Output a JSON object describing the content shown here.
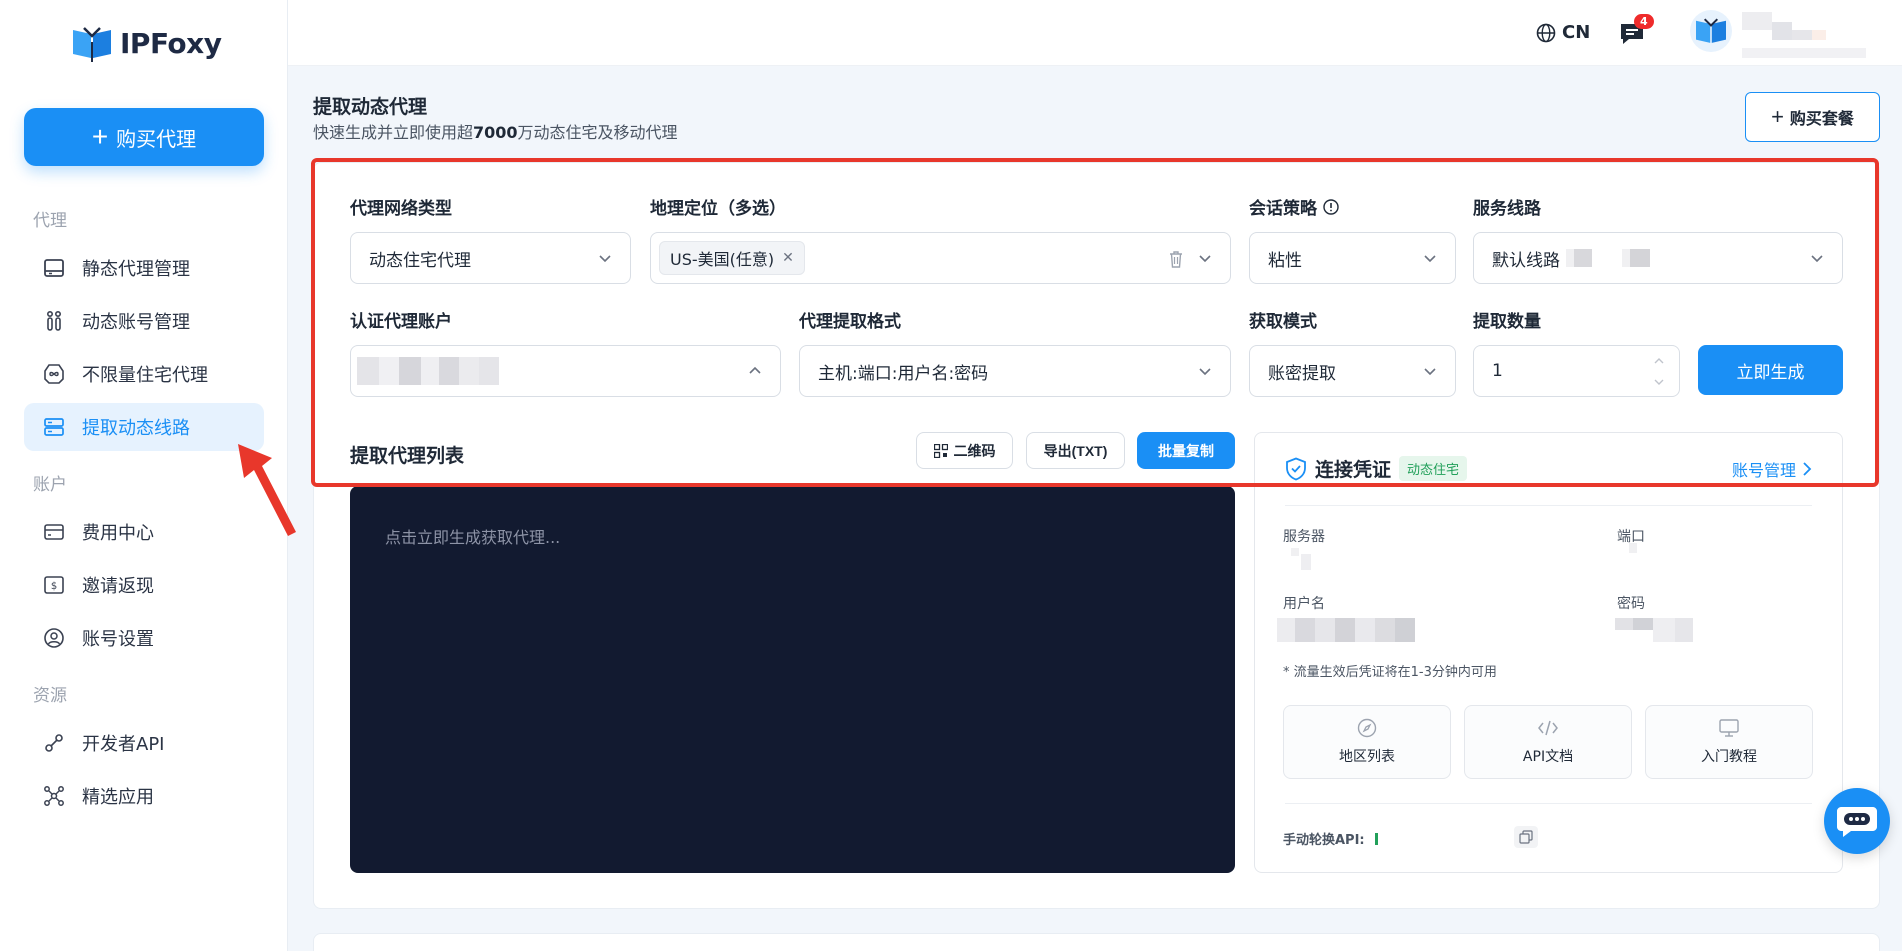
{
  "brand": {
    "name": "IPFoxy"
  },
  "sidebar": {
    "buy_label": "购买代理",
    "sections": {
      "proxy": "代理",
      "account": "账户",
      "resources": "资源"
    },
    "items": [
      {
        "label": "静态代理管理",
        "icon": "server-icon"
      },
      {
        "label": "动态账号管理",
        "icon": "users-icon"
      },
      {
        "label": "不限量住宅代理",
        "icon": "infinity-icon"
      },
      {
        "label": "提取动态线路",
        "icon": "list-icon",
        "active": true
      },
      {
        "label": "费用中心",
        "icon": "card-icon"
      },
      {
        "label": "邀请返现",
        "icon": "dollar-icon"
      },
      {
        "label": "账号设置",
        "icon": "user-icon"
      },
      {
        "label": "开发者API",
        "icon": "api-icon"
      },
      {
        "label": "精选应用",
        "icon": "apps-icon"
      }
    ]
  },
  "topbar": {
    "lang": "CN",
    "message_count": "4"
  },
  "page": {
    "title": "提取动态代理",
    "subtitle_pre": "快速生成并立即使用超",
    "subtitle_bold": "7000",
    "subtitle_post": "万动态住宅及移动代理",
    "buy_package": "购买套餐"
  },
  "form": {
    "network_type": {
      "label": "代理网络类型",
      "value": "动态住宅代理"
    },
    "geo": {
      "label": "地理定位（多选）",
      "tag": "US-美国(任意)"
    },
    "session": {
      "label": "会话策略",
      "value": "粘性"
    },
    "route": {
      "label": "服务线路",
      "value": "默认线路"
    },
    "auth_account": {
      "label": "认证代理账户"
    },
    "format": {
      "label": "代理提取格式",
      "value": "主机:端口:用户名:密码"
    },
    "mode": {
      "label": "获取模式",
      "value": "账密提取"
    },
    "quantity": {
      "label": "提取数量",
      "value": "1"
    },
    "generate": "立即生成"
  },
  "list": {
    "title": "提取代理列表",
    "qr": "二维码",
    "export": "导出(TXT)",
    "copy": "批量复制",
    "placeholder": "点击立即生成获取代理..."
  },
  "credential": {
    "title": "连接凭证",
    "badge": "动态住宅",
    "manage": "账号管理",
    "server": "服务器",
    "port": "端口",
    "username": "用户名",
    "password": "密码",
    "note": "* 流量生效后凭证将在1-3分钟内可用",
    "tiles": [
      "地区列表",
      "API文档",
      "入门教程"
    ],
    "rotate_api": "手动轮换API:"
  },
  "colors": {
    "accent": "#1a8ff5",
    "highlight": "#e8372b",
    "console_bg": "#121a30"
  }
}
